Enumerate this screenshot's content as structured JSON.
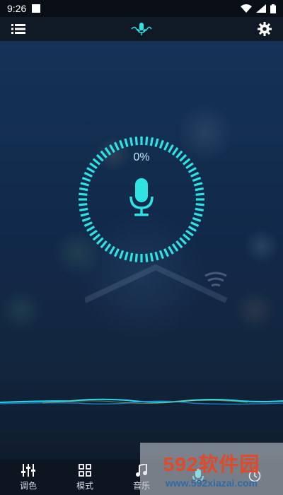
{
  "status_bar": {
    "time": "9:26"
  },
  "voice": {
    "percent_text": "0%"
  },
  "bottom_nav": {
    "items": [
      {
        "label": "调色",
        "icon": "sliders-icon"
      },
      {
        "label": "模式",
        "icon": "grid-icon"
      },
      {
        "label": "音乐",
        "icon": "music-icon"
      },
      {
        "label": "",
        "icon": "mic-icon"
      },
      {
        "label": "",
        "icon": "clock-icon"
      }
    ]
  },
  "watermark": {
    "main": "592软件园",
    "sub": "www.592xiazai.com"
  },
  "colors": {
    "accent": "#2fe3e3",
    "background_top": "#143356",
    "background_bottom": "#0f1c2c"
  }
}
